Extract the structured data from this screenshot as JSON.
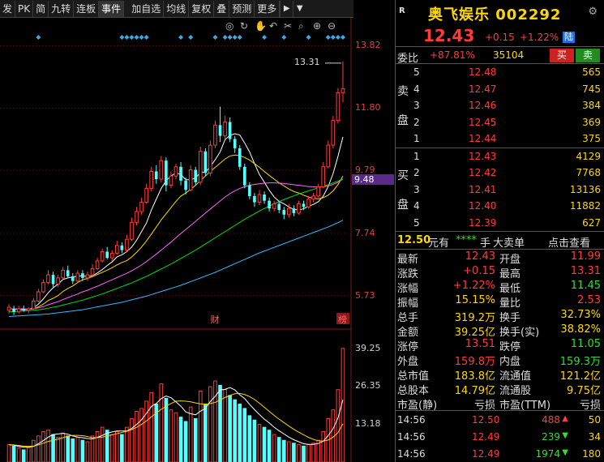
{
  "toolbar": {
    "buttons": [
      "发",
      "PK",
      "简",
      "九转",
      "连板",
      "事件",
      "加自选",
      "均线",
      "复权",
      "叠",
      "预测",
      "更多"
    ],
    "active_index": 5,
    "arrow_right": "▶",
    "arrow_down": "▼"
  },
  "chart_icons": [
    "◎",
    "↻",
    "✋",
    "↶",
    "✂",
    "⌕",
    "⊕",
    "⊖"
  ],
  "chart_data": {
    "type": "candlestick",
    "price_ticks": [
      "13.82",
      "11.80",
      "9.79",
      "7.74",
      "5.73"
    ],
    "volume_ticks": [
      "39.25",
      "26.35",
      "13.18"
    ],
    "price_range": [
      4.8,
      14.2
    ],
    "high_label": "13.31",
    "current_price_label": "9.48",
    "event_markers": [
      {
        "label": "财",
        "index": 42
      },
      {
        "label": "榜",
        "index": 68
      }
    ],
    "candles": [
      {
        "o": 5.25,
        "c": 5.35,
        "h": 5.45,
        "l": 5.15,
        "v": 6.0
      },
      {
        "o": 5.3,
        "c": 5.2,
        "h": 5.4,
        "l": 5.1,
        "v": 5.5
      },
      {
        "o": 5.2,
        "c": 5.3,
        "h": 5.4,
        "l": 5.15,
        "v": 4.8
      },
      {
        "o": 5.3,
        "c": 5.25,
        "h": 5.4,
        "l": 5.2,
        "v": 4.2
      },
      {
        "o": 5.25,
        "c": 5.3,
        "h": 5.35,
        "l": 5.15,
        "v": 5.0
      },
      {
        "o": 5.3,
        "c": 5.55,
        "h": 5.65,
        "l": 5.25,
        "v": 7.5
      },
      {
        "o": 5.55,
        "c": 5.85,
        "h": 5.95,
        "l": 5.5,
        "v": 9.0
      },
      {
        "o": 5.85,
        "c": 6.15,
        "h": 6.25,
        "l": 5.8,
        "v": 10.5
      },
      {
        "o": 6.15,
        "c": 6.4,
        "h": 6.55,
        "l": 6.1,
        "v": 11.0
      },
      {
        "o": 6.4,
        "c": 6.1,
        "h": 6.5,
        "l": 6.0,
        "v": 9.5
      },
      {
        "o": 6.1,
        "c": 6.3,
        "h": 6.4,
        "l": 6.0,
        "v": 8.5
      },
      {
        "o": 6.3,
        "c": 6.55,
        "h": 6.65,
        "l": 6.25,
        "v": 10.0
      },
      {
        "o": 6.55,
        "c": 6.35,
        "h": 6.7,
        "l": 6.3,
        "v": 9.0
      },
      {
        "o": 6.35,
        "c": 6.2,
        "h": 6.45,
        "l": 6.1,
        "v": 8.0
      },
      {
        "o": 6.2,
        "c": 6.45,
        "h": 6.55,
        "l": 6.15,
        "v": 8.5
      },
      {
        "o": 6.45,
        "c": 6.3,
        "h": 6.55,
        "l": 6.2,
        "v": 7.5
      },
      {
        "o": 6.3,
        "c": 6.4,
        "h": 6.5,
        "l": 6.2,
        "v": 7.0
      },
      {
        "o": 6.4,
        "c": 6.6,
        "h": 6.75,
        "l": 6.35,
        "v": 9.0
      },
      {
        "o": 6.6,
        "c": 6.85,
        "h": 6.95,
        "l": 6.55,
        "v": 10.5
      },
      {
        "o": 6.85,
        "c": 7.15,
        "h": 7.25,
        "l": 6.8,
        "v": 12.0
      },
      {
        "o": 7.15,
        "c": 6.95,
        "h": 7.3,
        "l": 6.9,
        "v": 11.0
      },
      {
        "o": 6.95,
        "c": 7.1,
        "h": 7.2,
        "l": 6.85,
        "v": 9.5
      },
      {
        "o": 7.1,
        "c": 7.35,
        "h": 7.5,
        "l": 7.05,
        "v": 10.5
      },
      {
        "o": 7.35,
        "c": 7.2,
        "h": 7.45,
        "l": 7.1,
        "v": 9.5
      },
      {
        "o": 7.2,
        "c": 7.55,
        "h": 7.7,
        "l": 7.15,
        "v": 12.0
      },
      {
        "o": 7.55,
        "c": 8.1,
        "h": 8.25,
        "l": 7.5,
        "v": 15.0
      },
      {
        "o": 8.1,
        "c": 8.45,
        "h": 8.6,
        "l": 8.0,
        "v": 17.5
      },
      {
        "o": 8.45,
        "c": 8.75,
        "h": 8.9,
        "l": 8.35,
        "v": 18.5
      },
      {
        "o": 8.75,
        "c": 9.2,
        "h": 9.35,
        "l": 8.7,
        "v": 21.0
      },
      {
        "o": 9.2,
        "c": 9.75,
        "h": 9.9,
        "l": 9.1,
        "v": 24.0
      },
      {
        "o": 9.75,
        "c": 9.5,
        "h": 9.95,
        "l": 9.35,
        "v": 20.0
      },
      {
        "o": 9.5,
        "c": 10.1,
        "h": 10.25,
        "l": 9.4,
        "v": 27.0
      },
      {
        "o": 10.1,
        "c": 9.3,
        "h": 10.2,
        "l": 9.1,
        "v": 22.0
      },
      {
        "o": 9.3,
        "c": 9.6,
        "h": 9.75,
        "l": 9.2,
        "v": 18.0
      },
      {
        "o": 9.6,
        "c": 9.9,
        "h": 10.0,
        "l": 9.5,
        "v": 17.0
      },
      {
        "o": 9.9,
        "c": 9.45,
        "h": 10.05,
        "l": 9.3,
        "v": 15.5
      },
      {
        "o": 9.45,
        "c": 9.15,
        "h": 9.55,
        "l": 9.0,
        "v": 14.0
      },
      {
        "o": 9.15,
        "c": 9.8,
        "h": 9.95,
        "l": 9.1,
        "v": 19.0
      },
      {
        "o": 9.8,
        "c": 9.4,
        "h": 9.9,
        "l": 9.3,
        "v": 15.0
      },
      {
        "o": 9.4,
        "c": 10.4,
        "h": 10.55,
        "l": 9.3,
        "v": 24.5
      },
      {
        "o": 10.4,
        "c": 9.7,
        "h": 10.5,
        "l": 9.6,
        "v": 20.0
      },
      {
        "o": 9.7,
        "c": 10.6,
        "h": 10.75,
        "l": 9.6,
        "v": 26.0
      },
      {
        "o": 10.6,
        "c": 11.25,
        "h": 11.4,
        "l": 10.5,
        "v": 28.0
      },
      {
        "o": 11.25,
        "c": 10.9,
        "h": 11.85,
        "l": 10.7,
        "v": 26.5
      },
      {
        "o": 10.9,
        "c": 11.35,
        "h": 11.55,
        "l": 10.8,
        "v": 25.0
      },
      {
        "o": 11.35,
        "c": 10.8,
        "h": 11.5,
        "l": 10.7,
        "v": 23.0
      },
      {
        "o": 10.8,
        "c": 10.5,
        "h": 10.9,
        "l": 10.35,
        "v": 21.5
      },
      {
        "o": 10.5,
        "c": 9.9,
        "h": 10.6,
        "l": 9.8,
        "v": 20.0
      },
      {
        "o": 9.9,
        "c": 9.3,
        "h": 10.0,
        "l": 9.2,
        "v": 18.5
      },
      {
        "o": 9.3,
        "c": 8.95,
        "h": 9.4,
        "l": 8.85,
        "v": 16.0
      },
      {
        "o": 8.95,
        "c": 8.75,
        "h": 9.05,
        "l": 8.6,
        "v": 14.5
      },
      {
        "o": 8.75,
        "c": 9.0,
        "h": 9.15,
        "l": 8.65,
        "v": 13.0
      },
      {
        "o": 9.0,
        "c": 8.8,
        "h": 9.1,
        "l": 8.7,
        "v": 12.0
      },
      {
        "o": 8.8,
        "c": 8.55,
        "h": 8.9,
        "l": 8.45,
        "v": 11.0
      },
      {
        "o": 8.55,
        "c": 8.7,
        "h": 8.8,
        "l": 8.45,
        "v": 9.5
      },
      {
        "o": 8.7,
        "c": 8.5,
        "h": 8.8,
        "l": 8.4,
        "v": 8.5
      },
      {
        "o": 8.5,
        "c": 8.35,
        "h": 8.6,
        "l": 8.2,
        "v": 7.5
      },
      {
        "o": 8.35,
        "c": 8.55,
        "h": 8.7,
        "l": 8.25,
        "v": 7.0
      },
      {
        "o": 8.55,
        "c": 8.4,
        "h": 8.65,
        "l": 8.3,
        "v": 6.5
      },
      {
        "o": 8.4,
        "c": 8.7,
        "h": 8.8,
        "l": 8.35,
        "v": 6.0
      },
      {
        "o": 8.7,
        "c": 8.6,
        "h": 8.8,
        "l": 8.5,
        "v": 5.5
      },
      {
        "o": 8.6,
        "c": 8.85,
        "h": 8.95,
        "l": 8.55,
        "v": 6.0
      },
      {
        "o": 8.85,
        "c": 8.95,
        "h": 9.05,
        "l": 8.75,
        "v": 6.5
      },
      {
        "o": 8.95,
        "c": 9.25,
        "h": 9.35,
        "l": 8.9,
        "v": 7.5
      },
      {
        "o": 9.25,
        "c": 9.9,
        "h": 10.05,
        "l": 9.2,
        "v": 10.5
      },
      {
        "o": 9.9,
        "c": 10.6,
        "h": 10.75,
        "l": 9.85,
        "v": 15.0
      },
      {
        "o": 10.6,
        "c": 11.4,
        "h": 11.55,
        "l": 10.5,
        "v": 18.0
      },
      {
        "o": 11.4,
        "c": 12.3,
        "h": 12.45,
        "l": 11.3,
        "v": 25.0
      },
      {
        "o": 12.3,
        "c": 12.43,
        "h": 13.31,
        "l": 11.99,
        "v": 39.25
      }
    ],
    "ma": [
      {
        "color": "#ffffff",
        "values": [
          5.3,
          5.3,
          5.28,
          5.27,
          5.28,
          5.33,
          5.45,
          5.62,
          5.82,
          5.98,
          6.1,
          6.25,
          6.3,
          6.33,
          6.36,
          6.37,
          6.34,
          6.37,
          6.46,
          6.57,
          6.7,
          6.82,
          6.98,
          7.05,
          7.15,
          7.3,
          7.52,
          7.8,
          8.08,
          8.5,
          8.85,
          9.2,
          9.45,
          9.6,
          9.7,
          9.65,
          9.48,
          9.48,
          9.54,
          9.72,
          9.72,
          9.91,
          10.13,
          10.38,
          10.78,
          10.92,
          10.97,
          10.93,
          10.67,
          10.38,
          10.0,
          9.65,
          9.4,
          9.14,
          8.92,
          8.78,
          8.7,
          8.6,
          8.52,
          8.5,
          8.54,
          8.62,
          8.68,
          8.77,
          8.95,
          9.26,
          9.68,
          10.24,
          10.87
        ]
      },
      {
        "color": "#ffd700",
        "values": [
          5.3,
          5.3,
          5.3,
          5.28,
          5.28,
          5.3,
          5.36,
          5.45,
          5.57,
          5.64,
          5.73,
          5.86,
          5.96,
          6.04,
          6.15,
          6.24,
          6.28,
          6.34,
          6.41,
          6.48,
          6.55,
          6.63,
          6.72,
          6.8,
          6.86,
          6.98,
          7.13,
          7.3,
          7.5,
          7.72,
          7.95,
          8.18,
          8.38,
          8.58,
          8.78,
          8.95,
          9.05,
          9.17,
          9.3,
          9.45,
          9.6,
          9.75,
          9.88,
          10.02,
          10.15,
          10.25,
          10.28,
          10.26,
          10.2,
          10.12,
          10.0,
          9.88,
          9.75,
          9.62,
          9.5,
          9.38,
          9.28,
          9.18,
          9.1,
          9.05,
          8.98,
          8.92,
          8.88,
          8.86,
          8.9,
          8.98,
          9.12,
          9.32,
          9.6
        ]
      },
      {
        "color": "#ff66ff",
        "values": [
          5.3,
          5.3,
          5.3,
          5.3,
          5.29,
          5.3,
          5.33,
          5.37,
          5.43,
          5.48,
          5.53,
          5.6,
          5.66,
          5.72,
          5.78,
          5.85,
          5.9,
          5.97,
          6.03,
          6.1,
          6.17,
          6.24,
          6.31,
          6.38,
          6.45,
          6.53,
          6.62,
          6.72,
          6.83,
          6.95,
          7.07,
          7.2,
          7.33,
          7.46,
          7.6,
          7.74,
          7.87,
          8.0,
          8.13,
          8.27,
          8.4,
          8.53,
          8.66,
          8.79,
          8.92,
          9.03,
          9.12,
          9.2,
          9.25,
          9.3,
          9.33,
          9.35,
          9.37,
          9.38,
          9.38,
          9.37,
          9.36,
          9.34,
          9.32,
          9.3,
          9.28,
          9.26,
          9.25,
          9.24,
          9.25,
          9.28,
          9.33,
          9.4,
          9.5
        ]
      },
      {
        "color": "#00dd00",
        "values": [
          5.2,
          5.21,
          5.22,
          5.23,
          5.24,
          5.25,
          5.27,
          5.29,
          5.32,
          5.35,
          5.38,
          5.42,
          5.46,
          5.5,
          5.54,
          5.58,
          5.63,
          5.68,
          5.73,
          5.78,
          5.84,
          5.9,
          5.96,
          6.02,
          6.08,
          6.14,
          6.21,
          6.28,
          6.35,
          6.43,
          6.51,
          6.59,
          6.67,
          6.75,
          6.84,
          6.93,
          7.02,
          7.11,
          7.2,
          7.3,
          7.4,
          7.5,
          7.6,
          7.7,
          7.8,
          7.9,
          8.0,
          8.1,
          8.2,
          8.29,
          8.38,
          8.47,
          8.55,
          8.63,
          8.7,
          8.77,
          8.84,
          8.9,
          8.96,
          9.02,
          9.07,
          9.12,
          9.17,
          9.22,
          9.27,
          9.32,
          9.38,
          9.44,
          9.5
        ]
      },
      {
        "color": "#33bbff",
        "values": [
          5.05,
          5.06,
          5.07,
          5.08,
          5.09,
          5.1,
          5.11,
          5.12,
          5.13,
          5.15,
          5.17,
          5.19,
          5.21,
          5.23,
          5.25,
          5.27,
          5.3,
          5.33,
          5.36,
          5.39,
          5.42,
          5.45,
          5.48,
          5.51,
          5.55,
          5.59,
          5.63,
          5.67,
          5.71,
          5.76,
          5.81,
          5.86,
          5.91,
          5.96,
          6.01,
          6.06,
          6.12,
          6.18,
          6.24,
          6.3,
          6.36,
          6.42,
          6.48,
          6.55,
          6.62,
          6.69,
          6.76,
          6.83,
          6.9,
          6.97,
          7.04,
          7.11,
          7.17,
          7.23,
          7.29,
          7.35,
          7.41,
          7.47,
          7.53,
          7.59,
          7.65,
          7.71,
          7.77,
          7.83,
          7.89,
          7.95,
          8.02,
          8.09,
          8.17
        ]
      }
    ],
    "vol_ma": [
      {
        "color": "#ffffff",
        "values": [
          6,
          5.8,
          5.4,
          5.1,
          5.1,
          5.4,
          6.3,
          7.4,
          8.6,
          9.5,
          9.7,
          9.9,
          9.6,
          9.0,
          8.6,
          8.4,
          8.1,
          8.0,
          8.5,
          9.2,
          9.9,
          10.4,
          10.7,
          10.7,
          10.7,
          11.6,
          13.0,
          14.6,
          16.8,
          19.2,
          20.2,
          21.9,
          22.8,
          22.2,
          20.8,
          19.3,
          17.3,
          16.7,
          16.3,
          17.6,
          18.5,
          20.9,
          22.7,
          24.9,
          25.1,
          25.7,
          24.9,
          23.2,
          21.9,
          19.9,
          18.1,
          16.4,
          14.8,
          13.5,
          12.0,
          10.8,
          9.7,
          8.6,
          7.7,
          7.0,
          6.3,
          6.1,
          6.1,
          6.4,
          7.2,
          9.1,
          11.5,
          15.2,
          21.5
        ]
      },
      {
        "color": "#ffd700",
        "values": [
          6,
          5.9,
          5.7,
          5.5,
          5.4,
          5.5,
          5.9,
          6.5,
          7.1,
          7.5,
          7.9,
          8.4,
          8.9,
          9.2,
          9.2,
          9.1,
          8.8,
          8.4,
          8.4,
          8.6,
          9.0,
          9.4,
          9.8,
          10.2,
          10.6,
          11.2,
          12.0,
          13.0,
          14.2,
          15.6,
          16.9,
          18.2,
          19.3,
          20.2,
          21.0,
          21.1,
          21.0,
          20.8,
          20.4,
          20.1,
          20.0,
          20.2,
          20.6,
          21.4,
          22.3,
          23.0,
          23.6,
          23.7,
          23.3,
          22.6,
          21.6,
          20.3,
          18.9,
          17.5,
          16.1,
          14.8,
          13.6,
          12.4,
          11.3,
          10.3,
          9.4,
          8.5,
          7.8,
          7.3,
          7.2,
          7.6,
          8.6,
          10.2,
          13.2
        ]
      }
    ]
  },
  "stock": {
    "r_mark": "R",
    "name": "奥飞娱乐 002292",
    "settings_icon": "⚙",
    "price": "12.43",
    "change": "+0.15",
    "change_pct": "+1.22%",
    "exchange_tag": "陆"
  },
  "order_ratio": {
    "label": "委比",
    "pct": "+87.81%",
    "diff": "35104",
    "buy_btn": "买",
    "sell_btn": "卖"
  },
  "sell_side": {
    "label_top": "卖",
    "label_bottom": "盘",
    "rows": [
      {
        "level": "5",
        "price": "12.48",
        "qty": "565"
      },
      {
        "level": "4",
        "price": "12.47",
        "qty": "745"
      },
      {
        "level": "3",
        "price": "12.46",
        "qty": "384"
      },
      {
        "level": "2",
        "price": "12.45",
        "qty": "369"
      },
      {
        "level": "1",
        "price": "12.44",
        "qty": "375"
      }
    ]
  },
  "buy_side": {
    "label_top": "买",
    "label_bottom": "盘",
    "rows": [
      {
        "level": "1",
        "price": "12.43",
        "qty": "4129"
      },
      {
        "level": "2",
        "price": "12.42",
        "qty": "7768"
      },
      {
        "level": "3",
        "price": "12.41",
        "qty": "13136"
      },
      {
        "level": "4",
        "price": "12.40",
        "qty": "11882"
      },
      {
        "level": "5",
        "price": "12.39",
        "qty": "627"
      }
    ]
  },
  "big_seller": {
    "price": "12.50",
    "unit": "元有",
    "stars": "****",
    "hand": "手",
    "text": "大卖单",
    "link": "点击查看"
  },
  "stats": [
    {
      "l1": "最新",
      "v1": "12.43",
      "c1": "red",
      "l2": "开盘",
      "v2": "11.99",
      "c2": "red"
    },
    {
      "l1": "涨跌",
      "v1": "+0.15",
      "c1": "red",
      "l2": "最高",
      "v2": "13.31",
      "c2": "red"
    },
    {
      "l1": "涨幅",
      "v1": "+1.22%",
      "c1": "red",
      "l2": "最低",
      "v2": "11.45",
      "c2": "green"
    },
    {
      "l1": "振幅",
      "v1": "15.15%",
      "c1": "yellow",
      "l2": "量比",
      "v2": "2.53",
      "c2": "red"
    },
    {
      "l1": "总手",
      "v1": "319.2万",
      "c1": "yellow",
      "l2": "换手",
      "v2": "32.73%",
      "c2": "yellow"
    },
    {
      "l1": "金额",
      "v1": "39.25亿",
      "c1": "yellow",
      "l2": "换手(实)",
      "v2": "38.82%",
      "c2": "yellow"
    },
    {
      "l1": "涨停",
      "v1": "13.51",
      "c1": "red",
      "l2": "跌停",
      "v2": "11.05",
      "c2": "green"
    },
    {
      "l1": "外盘",
      "v1": "159.8万",
      "c1": "red",
      "l2": "内盘",
      "v2": "159.3万",
      "c2": "green"
    },
    {
      "l1": "总市值",
      "v1": "183.8亿",
      "c1": "yellow",
      "l2": "流通值",
      "v2": "121.2亿",
      "c2": "yellow"
    },
    {
      "l1": "总股本",
      "v1": "14.79亿",
      "c1": "yellow",
      "l2": "流通股",
      "v2": "9.75亿",
      "c2": "yellow"
    },
    {
      "l1": "市盈(静)",
      "v1": "亏损",
      "c1": "white",
      "l2": "市盈(TTM)",
      "v2": "亏损",
      "c2": "white"
    }
  ],
  "ticks": [
    {
      "time": "14:56",
      "price": "12.50",
      "vol": "488",
      "dir": "up",
      "num": "50"
    },
    {
      "time": "14:56",
      "price": "12.49",
      "vol": "239",
      "dir": "down",
      "num": "34"
    },
    {
      "time": "14:56",
      "price": "12.49",
      "vol": "1974",
      "dir": "down",
      "num": "180"
    }
  ]
}
